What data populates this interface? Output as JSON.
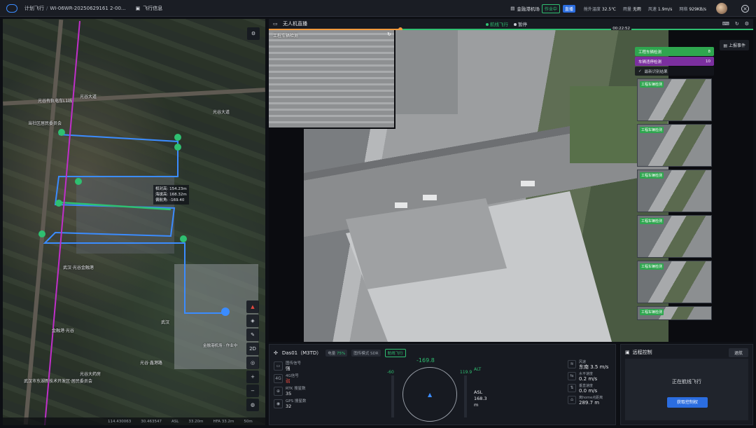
{
  "header": {
    "breadcrumb_1": "计划飞行",
    "breadcrumb_2": "WI-06WR-20250629161 2-00...",
    "flight_info_label": "飞行信息",
    "dock_name": "金融港机场",
    "dock_status": "作业中",
    "live_badge": "直播",
    "weather": {
      "temp_label": "舱外温度",
      "temp_value": "32.5℃",
      "rain_label": "雨量",
      "rain_value": "无雨",
      "wind_label": "风速",
      "wind_value": "1.9m/s",
      "net_label": "网络",
      "net_value": "929KB/s"
    }
  },
  "map": {
    "labels": {
      "road_1": "光谷大道",
      "road_2": "光谷大道",
      "metro": "光谷有轨电车L1线",
      "area_1": "当社区居民委员会",
      "area_2": "武汉·光谷金融港",
      "area_3": "金融港·光谷",
      "area_4": "武汉",
      "area_5": "光谷大药房",
      "area_6": "武汉市东湖新技术开发区·居民委员会",
      "area_7": "光谷·鑫港路"
    },
    "info_overlay": {
      "line_1": "相对高: 154.23m",
      "line_2": "海拔高: 168.32m",
      "line_3": "偏航角: -169.40"
    },
    "dock_tag": "金融港机场 · 作业中",
    "status": {
      "lon": "114.430063",
      "lat": "30.463547",
      "asl_label": "ASL",
      "asl_value": "33.20m",
      "hfa": "HFA 33.2m",
      "scale": "50m"
    },
    "tools": [
      "2D"
    ]
  },
  "video": {
    "title": "无人机直播",
    "state_1": "航线飞行",
    "state_2": "暂停",
    "time": "00:22:52",
    "pip_label": "工程车辆检测",
    "upload_button": "上报事件",
    "events": [
      {
        "label": "工程车辆检测",
        "count": "8"
      },
      {
        "label": "车辆违停检测",
        "count": "10"
      }
    ],
    "recent_label": "最新识别结果",
    "thumbs": [
      "工程车辆检测",
      "工程车辆检测",
      "工程车辆检测",
      "工程车辆检测",
      "工程车辆检测",
      "工程车辆检测"
    ]
  },
  "telemetry": {
    "drone": "Das01（M3TD）",
    "battery_label": "电量",
    "battery_value": "75%",
    "mode_label": "图传模式",
    "mode_value": "SDR",
    "flight_tag": "航线飞行",
    "signals": [
      {
        "label": "图传信号",
        "value": "强"
      },
      {
        "label": "4G信号",
        "value": "弱"
      },
      {
        "label": "RTK 搜星数",
        "value": "35"
      },
      {
        "label": "GPS 搜星数",
        "value": "32"
      }
    ],
    "heading": "-169.8",
    "left_val": "-60",
    "right_val": "119.9",
    "alt_label": "ALT",
    "asl_label": "ASL",
    "asl_value": "168.3 m",
    "stats": [
      {
        "label": "风速",
        "value": "东南 3.5 m/s"
      },
      {
        "label": "水平速度",
        "value": "0.2 m/s"
      },
      {
        "label": "垂直速度",
        "value": "0.0 m/s"
      },
      {
        "label": "离home点距离",
        "value": "289.7 m"
      }
    ]
  },
  "remote": {
    "title": "远程控制",
    "exit": "退航",
    "state": "正在航线飞行",
    "control_button": "获取控制权"
  },
  "colors": {
    "accent": "#2b6de0",
    "green": "#2fbf71",
    "orange": "#f39a3d",
    "purple": "#7b2f9f"
  }
}
